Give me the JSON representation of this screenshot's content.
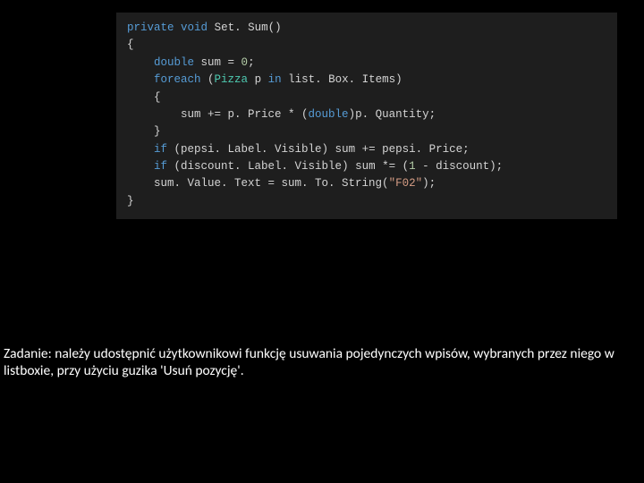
{
  "code": {
    "l1": {
      "kw1": "private",
      "kw2": "void",
      "name": "Set. Sum",
      "paren": "()"
    },
    "l2": "{",
    "l3": {
      "indent": "    ",
      "kw": "double",
      "rest": " sum = ",
      "num": "0",
      "semi": ";"
    },
    "l4": {
      "indent": "    ",
      "kw1": "foreach",
      "open": " (",
      "type": "Pizza",
      "sp1": " p ",
      "kw2": "in",
      "rest": " list. Box. Items)"
    },
    "l5": "    {",
    "l6": {
      "indent": "        ",
      "a": "sum += p. Price * (",
      "kw": "double",
      "b": ")p. Quantity;"
    },
    "l7": "    }",
    "l8": {
      "indent": "    ",
      "kw": "if",
      "rest": " (pepsi. Label. Visible) sum += pepsi. Price;"
    },
    "l9": {
      "indent": "    ",
      "kw": "if",
      "a": " (discount. Label. Visible) sum *= (",
      "num": "1",
      "b": " - discount);"
    },
    "l10": {
      "indent": "    ",
      "a": "sum. Value. Text = sum. To. String(",
      "str": "\"F02\"",
      "b": ");"
    },
    "l11": "}"
  },
  "task": "Zadanie: należy udostępnić użytkownikowi funkcję usuwania pojedynczych wpisów, wybranych przez niego w listboxie, przy użyciu guzika 'Usuń pozycję'."
}
